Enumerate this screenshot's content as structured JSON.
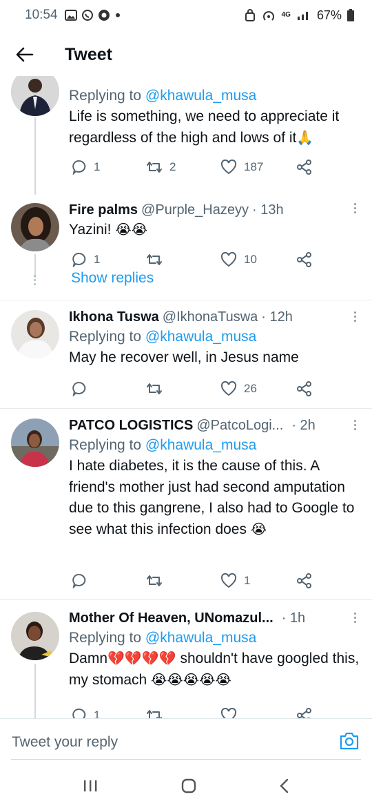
{
  "status_bar": {
    "time": "10:54",
    "network": "4G",
    "battery": "67%"
  },
  "header": {
    "title": "Tweet"
  },
  "tweets": [
    {
      "replying_label": "Replying to",
      "replying_handle": "@khawula_musa",
      "text": "Life is something, we need to appreciate it regardless of the high and lows of it",
      "emoji": "🙏",
      "replies": "1",
      "retweets": "2",
      "likes": "187"
    },
    {
      "name": "Fire palms",
      "handle": "@Purple_Hazeyy",
      "time": "· 13h",
      "text": "Yazini!",
      "emoji": "😭😭",
      "replies": "1",
      "retweets": "",
      "likes": "10",
      "show_replies": "Show replies"
    },
    {
      "name": "Ikhona Tuswa",
      "handle": "@IkhonaTuswa",
      "time": "· 12h",
      "replying_label": "Replying to",
      "replying_handle": "@khawula_musa",
      "text": "May he recover well, in Jesus name",
      "replies": "",
      "retweets": "",
      "likes": "26"
    },
    {
      "name": "PATCO LOGISTICS",
      "handle": "@PatcoLogi...",
      "time": "· 2h",
      "replying_label": "Replying to",
      "replying_handle": "@khawula_musa",
      "text": "I hate diabetes, it is the cause of this. A friend's mother just had second amputation due to this gangrene, I also had to Google to see what this infection does",
      "emoji": "😭",
      "replies": "",
      "retweets": "",
      "likes": "1"
    },
    {
      "name": "Mother Of Heaven, UNomazul...",
      "handle": "",
      "time": "· 1h",
      "replying_label": "Replying to",
      "replying_handle": "@khawula_musa",
      "text_a": "Damn",
      "emoji_a": "💔💔💔💔",
      "text_b": " shouldn't have googled this, my stomach ",
      "emoji_b": "😭😭😭😭😭",
      "replies": "1",
      "retweets": "",
      "likes": ""
    }
  ],
  "compose": {
    "placeholder": "Tweet your reply"
  },
  "colors": {
    "accent": "#1d9bf0",
    "secondary_text": "#536471"
  }
}
